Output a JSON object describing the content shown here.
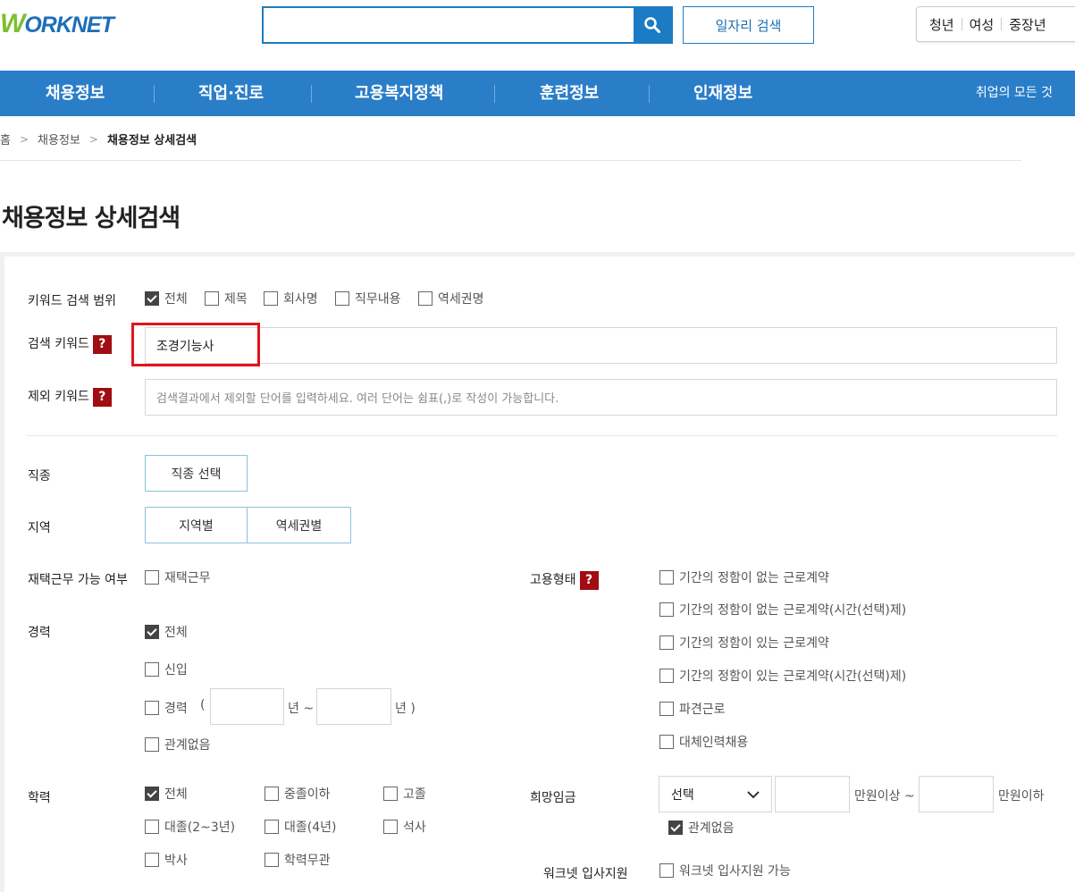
{
  "header": {
    "logo_text": "WORKNET",
    "search_placeholder": "",
    "job_search_label": "일자리 검색",
    "user_tabs": [
      "청년",
      "여성",
      "중장년"
    ]
  },
  "nav": {
    "items": [
      "채용정보",
      "직업·진로",
      "고용복지정책",
      "훈련정보",
      "인재정보"
    ],
    "right_link": "취업의 모든 것"
  },
  "breadcrumb": [
    "홈",
    "채용정보",
    "채용정보 상세검색"
  ],
  "page_title": "채용정보 상세검색",
  "form": {
    "keyword_scope": {
      "label": "키워드 검색 범위",
      "options": [
        {
          "label": "전체",
          "checked": true
        },
        {
          "label": "제목",
          "checked": false
        },
        {
          "label": "회사명",
          "checked": false
        },
        {
          "label": "직무내용",
          "checked": false
        },
        {
          "label": "역세권명",
          "checked": false
        }
      ]
    },
    "search_keyword": {
      "label": "검색 키워드",
      "help": "?",
      "value": "조경기능사"
    },
    "exclude_keyword": {
      "label": "제외 키워드",
      "help": "?",
      "placeholder": "검색결과에서 제외할 단어를 입력하세요. 여러 단어는 쉼표(,)로 작성이 가능합니다."
    },
    "occupation": {
      "label": "직종",
      "button": "직종 선택"
    },
    "region": {
      "label": "지역",
      "buttons": [
        "지역별",
        "역세권별"
      ]
    },
    "remote": {
      "label": "재택근무 가능 여부",
      "option": "재택근무",
      "checked": false
    },
    "career": {
      "label": "경력",
      "all": "전체",
      "new": "신입",
      "experienced": "경력",
      "paren_open": "(",
      "year_from": "년 ~",
      "year_to": "년 )",
      "irrelevant": "관계없음"
    },
    "education": {
      "label": "학력",
      "options": [
        "전체",
        "중졸이하",
        "고졸",
        "대졸(2~3년)",
        "대졸(4년)",
        "석사",
        "박사",
        "학력무관"
      ]
    },
    "employment_type": {
      "label": "고용형태",
      "help": "?",
      "options": [
        "기간의 정함이 없는 근로계약",
        "기간의 정함이 없는 근로계약(시간(선택)제)",
        "기간의 정함이 있는 근로계약",
        "기간의 정함이 있는 근로계약(시간(선택)제)",
        "파견근로",
        "대체인력채용"
      ]
    },
    "salary": {
      "label": "희망임금",
      "select_value": "선택",
      "min_suffix": "만원이상 ~",
      "max_suffix": "만원이하",
      "irrelevant": "관계없음"
    },
    "worknet_apply": {
      "label": "워크넷 입사지원",
      "option": "워크넷 입사지원 가능"
    }
  },
  "colors": {
    "nav_bg": "#2a7ec8",
    "help_bg": "#a00d12",
    "highlight": "#e0141b",
    "brand_green": "#7cbf2f",
    "brand_blue": "#1e6fb8"
  }
}
